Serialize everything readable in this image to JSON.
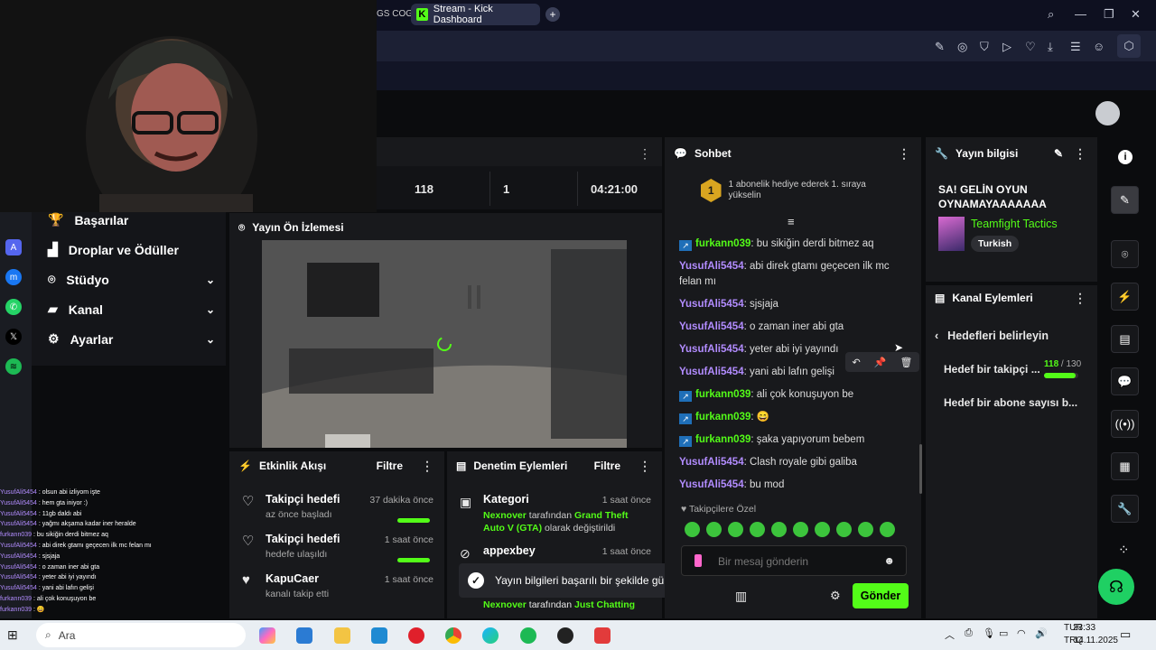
{
  "browser": {
    "tab_partial": "GS COG",
    "tab_title": "Stream - Kick Dashboard",
    "new_tab": "+"
  },
  "nav": {
    "items": [
      {
        "label": "Başarılar",
        "icon": "trophy-icon"
      },
      {
        "label": "Droplar ve Ödüller",
        "icon": "gift-icon"
      },
      {
        "label": "Stüdyo",
        "icon": "studio-icon"
      },
      {
        "label": "Kanal",
        "icon": "broadcast-icon"
      },
      {
        "label": "Ayarlar",
        "icon": "gear-icon"
      }
    ]
  },
  "overlay_chat": [
    {
      "user": "YusufAli5454",
      "text": "olsun abi izliyom işte"
    },
    {
      "user": "YusufAli5454",
      "text": "hem gta iniyor :)"
    },
    {
      "user": "YusufAli5454",
      "text": "11gb daldı abi"
    },
    {
      "user": "YusufAli5454",
      "text": "yağmı akşama kadar iner heralde"
    },
    {
      "user": "furkann039",
      "text": "bu sikiğin derdi bitmez aq"
    },
    {
      "user": "YusufAli5454",
      "text": "abi direk gtamı geçecen ilk mc felan mı"
    },
    {
      "user": "YusufAli5454",
      "text": "sjsjaja"
    },
    {
      "user": "YusufAli5454",
      "text": "o zaman iner abi gta"
    },
    {
      "user": "YusufAli5454",
      "text": "yeter abi iyi yayındı"
    },
    {
      "user": "YusufAli5454",
      "text": "yani abi lafın gelişi"
    },
    {
      "user": "furkann039",
      "text": "ali çok konuşuyon be"
    },
    {
      "user": "furkann039",
      "text": "😄"
    }
  ],
  "stats": {
    "viewers": "118",
    "followers": "1",
    "uptime": "04:21:00"
  },
  "preview": {
    "title": "Yayın Ön İzlemesi"
  },
  "activity": {
    "title": "Etkinlik Akışı",
    "filter": "Filtre",
    "items": [
      {
        "title": "Takipçi hedefi",
        "sub": "az önce başladı",
        "time": "37 dakika önce"
      },
      {
        "title": "Takipçi hedefi",
        "sub": "hedefe ulaşıldı",
        "time": "1 saat önce"
      },
      {
        "title": "KapuCaer",
        "sub": "kanalı takip etti",
        "time": "1 saat önce"
      }
    ]
  },
  "moderation": {
    "title": "Denetim Eylemleri",
    "filter": "Filtre",
    "item1": {
      "title": "Kategori",
      "time": "1 saat önce",
      "actor": "Nexnover",
      "mid": " tarafından ",
      "target": "Grand Theft Auto V (GTA)",
      "suffix": " olarak değiştirildi"
    },
    "item2": {
      "title": "appexbey",
      "time": "1 saat önce"
    },
    "item3": {
      "actor": "Nexnover",
      "mid": " tarafından ",
      "target": "Just Chatting"
    }
  },
  "toast": "Yayın bilgileri başarılı bir şekilde güncellendi.",
  "chat": {
    "title": "Sohbet",
    "pinned_rank": "1",
    "pinned_text": "1 abonelik hediye ederek 1. sıraya yükselin",
    "messages": [
      {
        "user": "furkann039",
        "text": "bu sikiğin derdi bitmez aq",
        "badge": true
      },
      {
        "user": "YusufAli5454",
        "text": "abi direk gtamı geçecen ilk mc felan mı",
        "badge": false
      },
      {
        "user": "YusufAli5454",
        "text": "sjsjaja",
        "badge": false
      },
      {
        "user": "YusufAli5454",
        "text": "o zaman iner abi gta",
        "badge": false
      },
      {
        "user": "YusufAli5454",
        "text": "yeter abi iyi yayındı",
        "badge": false
      },
      {
        "user": "YusufAli5454",
        "text": "yani abi lafın gelişi",
        "badge": false
      },
      {
        "user": "furkann039",
        "text": "ali çok konuşuyon be",
        "badge": true
      },
      {
        "user": "furkann039",
        "text": "😄",
        "badge": true
      },
      {
        "user": "furkann039",
        "text": "şaka yapıyorum bebem",
        "badge": true
      },
      {
        "user": "YusufAli5454",
        "text": "Clash royale gibi galiba",
        "badge": false
      },
      {
        "user": "YusufAli5454",
        "text": "bu mod",
        "badge": false
      }
    ],
    "emote_label": "Takipçilere Özel",
    "input_placeholder": "Bir mesaj gönderin",
    "send_label": "Gönder"
  },
  "streaminfo": {
    "title": "Yayın bilgisi",
    "stream_title": "SA! GELİN OYUN OYNAMAYAAAAAAA",
    "category": "Teamfight Tactics",
    "language": "Turkish"
  },
  "channel_actions": {
    "title": "Kanal Eylemleri",
    "back_label": "Hedefleri belirleyin",
    "goal1": "Hedef bir takipçi ...",
    "goal1_current": "118",
    "goal1_sep": " / ",
    "goal1_target": "130",
    "goal1_progress": 0.91,
    "goal2": "Hedef bir abone sayısı b..."
  },
  "taskbar": {
    "search": "Ara",
    "lang": "TUR",
    "lang2": "TRQ",
    "time": "23:33",
    "date": "14.11.2025"
  },
  "colors": {
    "accent": "#53fc18",
    "user": "#b28cff",
    "panel": "#18191c"
  }
}
